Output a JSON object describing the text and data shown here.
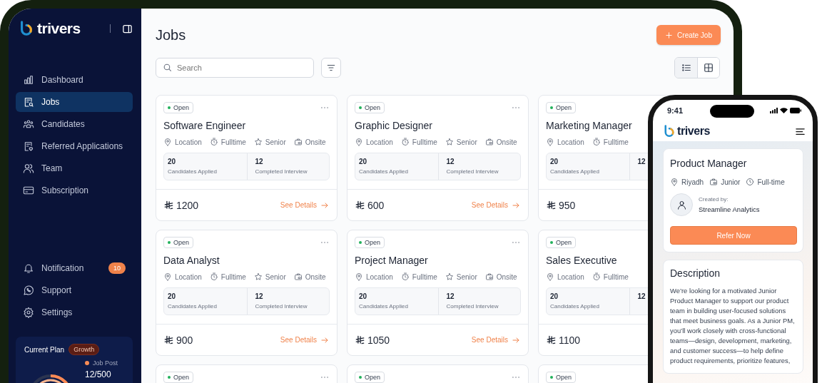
{
  "sidebar": {
    "brand": "trivers",
    "nav": [
      {
        "kind": "dashboard",
        "label": "Dashboard",
        "selected": false
      },
      {
        "kind": "jobs",
        "label": "Jobs",
        "selected": true
      },
      {
        "kind": "candidates",
        "label": "Candidates",
        "selected": false
      },
      {
        "kind": "referrals",
        "label": "Referred Applications",
        "selected": false
      },
      {
        "kind": "team",
        "label": "Team",
        "selected": false
      },
      {
        "kind": "subscription",
        "label": "Subscription",
        "selected": false
      }
    ],
    "bottom_nav": [
      {
        "kind": "notification",
        "label": "Notification",
        "badge": "10"
      },
      {
        "kind": "support",
        "label": "Support"
      },
      {
        "kind": "settings",
        "label": "Settings"
      }
    ],
    "plan": {
      "title": "Current Plan",
      "badge": "Growth",
      "legend": "Job Post",
      "value": "12/500"
    }
  },
  "main": {
    "title": "Jobs",
    "create_button": "Create Job",
    "search": {
      "placeholder": "Search"
    },
    "views": [
      {
        "kind": "list",
        "selected": true
      },
      {
        "kind": "grid",
        "selected": false
      }
    ],
    "jobs": [
      {
        "status": "Open",
        "title": "Software Engineer",
        "tags": [
          {
            "kind": "location",
            "label": "Location"
          },
          {
            "kind": "employment",
            "label": "Fulltime"
          },
          {
            "kind": "level",
            "label": "Senior"
          },
          {
            "kind": "workplace",
            "label": "Onsite"
          }
        ],
        "stats": [
          {
            "value": "20",
            "label": "Candidates Applied"
          },
          {
            "value": "12",
            "label": "Completed Interview"
          }
        ],
        "price": "1200",
        "link": "See Details"
      },
      {
        "status": "Open",
        "title": "Graphic Designer",
        "tags": [
          {
            "kind": "location",
            "label": "Location"
          },
          {
            "kind": "employment",
            "label": "Fulltime"
          },
          {
            "kind": "level",
            "label": "Senior"
          },
          {
            "kind": "workplace",
            "label": "Onsite"
          }
        ],
        "stats": [
          {
            "value": "20",
            "label": "Candidates Applied"
          },
          {
            "value": "12",
            "label": "Completed Interview"
          }
        ],
        "price": "600",
        "link": "See Details"
      },
      {
        "status": "Open",
        "title": "Marketing Manager",
        "tags": [
          {
            "kind": "location",
            "label": "Location"
          },
          {
            "kind": "employment",
            "label": "Fulltime"
          }
        ],
        "stats": [
          {
            "value": "20",
            "label": "Candidates Applied"
          },
          {
            "value": "12"
          }
        ],
        "price": "950"
      },
      {
        "status": "Open",
        "title": "Data Analyst",
        "tags": [
          {
            "kind": "location",
            "label": "Location"
          },
          {
            "kind": "employment",
            "label": "Fulltime"
          },
          {
            "kind": "level",
            "label": "Senior"
          },
          {
            "kind": "workplace",
            "label": "Onsite"
          }
        ],
        "stats": [
          {
            "value": "20",
            "label": "Candidates Applied"
          },
          {
            "value": "12",
            "label": "Completed Interview"
          }
        ],
        "price": "900",
        "link": "See Details"
      },
      {
        "status": "Open",
        "title": "Project Manager",
        "tags": [
          {
            "kind": "location",
            "label": "Location"
          },
          {
            "kind": "employment",
            "label": "Fulltime"
          },
          {
            "kind": "level",
            "label": "Senior"
          },
          {
            "kind": "workplace",
            "label": "Onsite"
          }
        ],
        "stats": [
          {
            "value": "20",
            "label": "Candidates Applied"
          },
          {
            "value": "12",
            "label": "Completed Interview"
          }
        ],
        "price": "1050",
        "link": "See Details"
      },
      {
        "status": "Open",
        "title": "Sales Executive",
        "tags": [
          {
            "kind": "location",
            "label": "Location"
          },
          {
            "kind": "employment",
            "label": "Fulltime"
          }
        ],
        "stats": [
          {
            "value": "20",
            "label": "Candidates Applied"
          },
          {
            "value": "12"
          }
        ],
        "price": "1100"
      },
      {
        "status": "Open"
      },
      {
        "status": "Open"
      },
      {
        "status": "Open"
      }
    ]
  },
  "phone": {
    "time": "9:41",
    "brand": "trivers",
    "job": {
      "title": "Product Manager",
      "tags": [
        {
          "kind": "location",
          "label": "Riyadh"
        },
        {
          "kind": "level",
          "label": "Junior"
        },
        {
          "kind": "schedule",
          "label": "Full-time"
        }
      ],
      "created_label": "Created by:",
      "company": "Streamline Analytics",
      "button": "Refer Now"
    },
    "description": {
      "title": "Description",
      "text": "We’re looking for a motivated Junior Product Manager to support our product team in building user-focused solutions that meet business goals. As a Junior PM, you’ll work closely with cross-functional teams—design, development, marketing, and customer success—to help define product requirements, prioritize features,"
    }
  }
}
